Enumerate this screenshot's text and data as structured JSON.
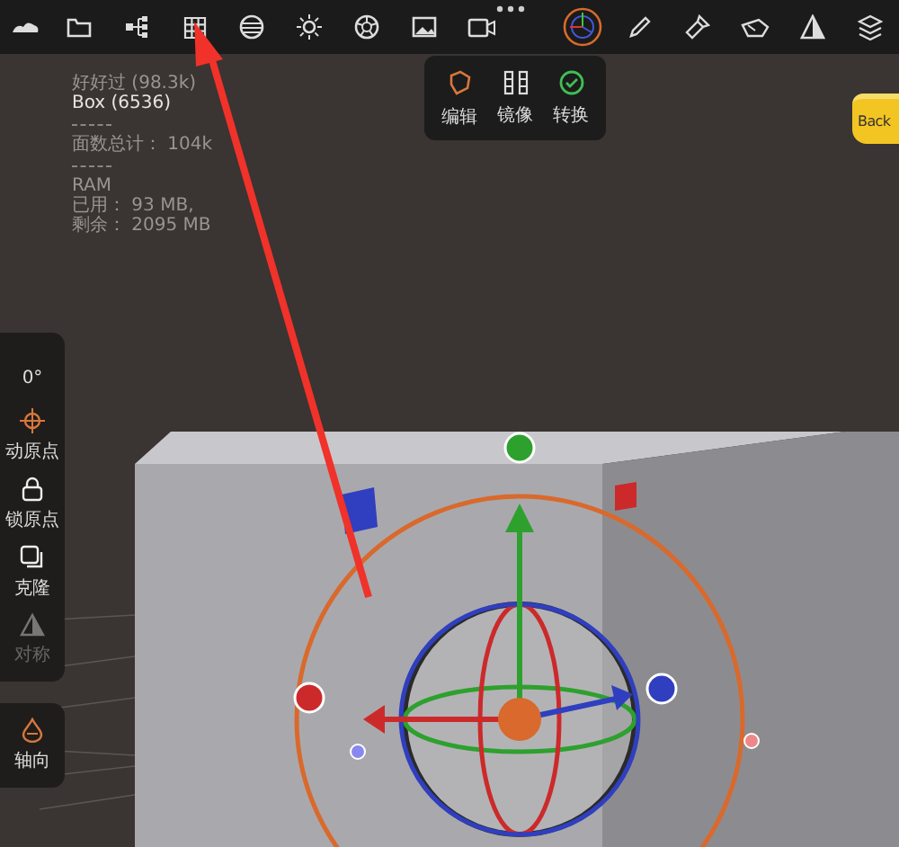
{
  "stats": {
    "lines": [
      {
        "kind": "dim",
        "text": "好好过 (98.3k)"
      },
      {
        "kind": "bright",
        "text": "Box (6536)"
      },
      {
        "kind": "rule"
      },
      {
        "kind": "dim",
        "text": "面数总计： 104k"
      },
      {
        "kind": "rule"
      },
      {
        "kind": "dim",
        "text": "RAM"
      },
      {
        "kind": "dim",
        "text": "已用： 93 MB,"
      },
      {
        "kind": "dim",
        "text": "剩余： 2095 MB"
      }
    ]
  },
  "popup": {
    "items": [
      {
        "kind": "edit",
        "label": "编辑"
      },
      {
        "kind": "mirror",
        "label": "镜像"
      },
      {
        "kind": "convert",
        "label": "转换"
      }
    ]
  },
  "side_panel": {
    "angle": "0°",
    "tools": [
      {
        "kind": "move-origin",
        "label": "动原点",
        "disabled": false
      },
      {
        "kind": "lock",
        "label": "锁原点",
        "disabled": false
      },
      {
        "kind": "clone",
        "label": "克隆",
        "disabled": false
      },
      {
        "kind": "symmetry",
        "label": "对称",
        "disabled": true
      }
    ]
  },
  "axis_panel": {
    "tools": [
      {
        "kind": "axis",
        "label": "轴向",
        "disabled": false
      }
    ]
  },
  "view_cube": {
    "label": "Back"
  }
}
